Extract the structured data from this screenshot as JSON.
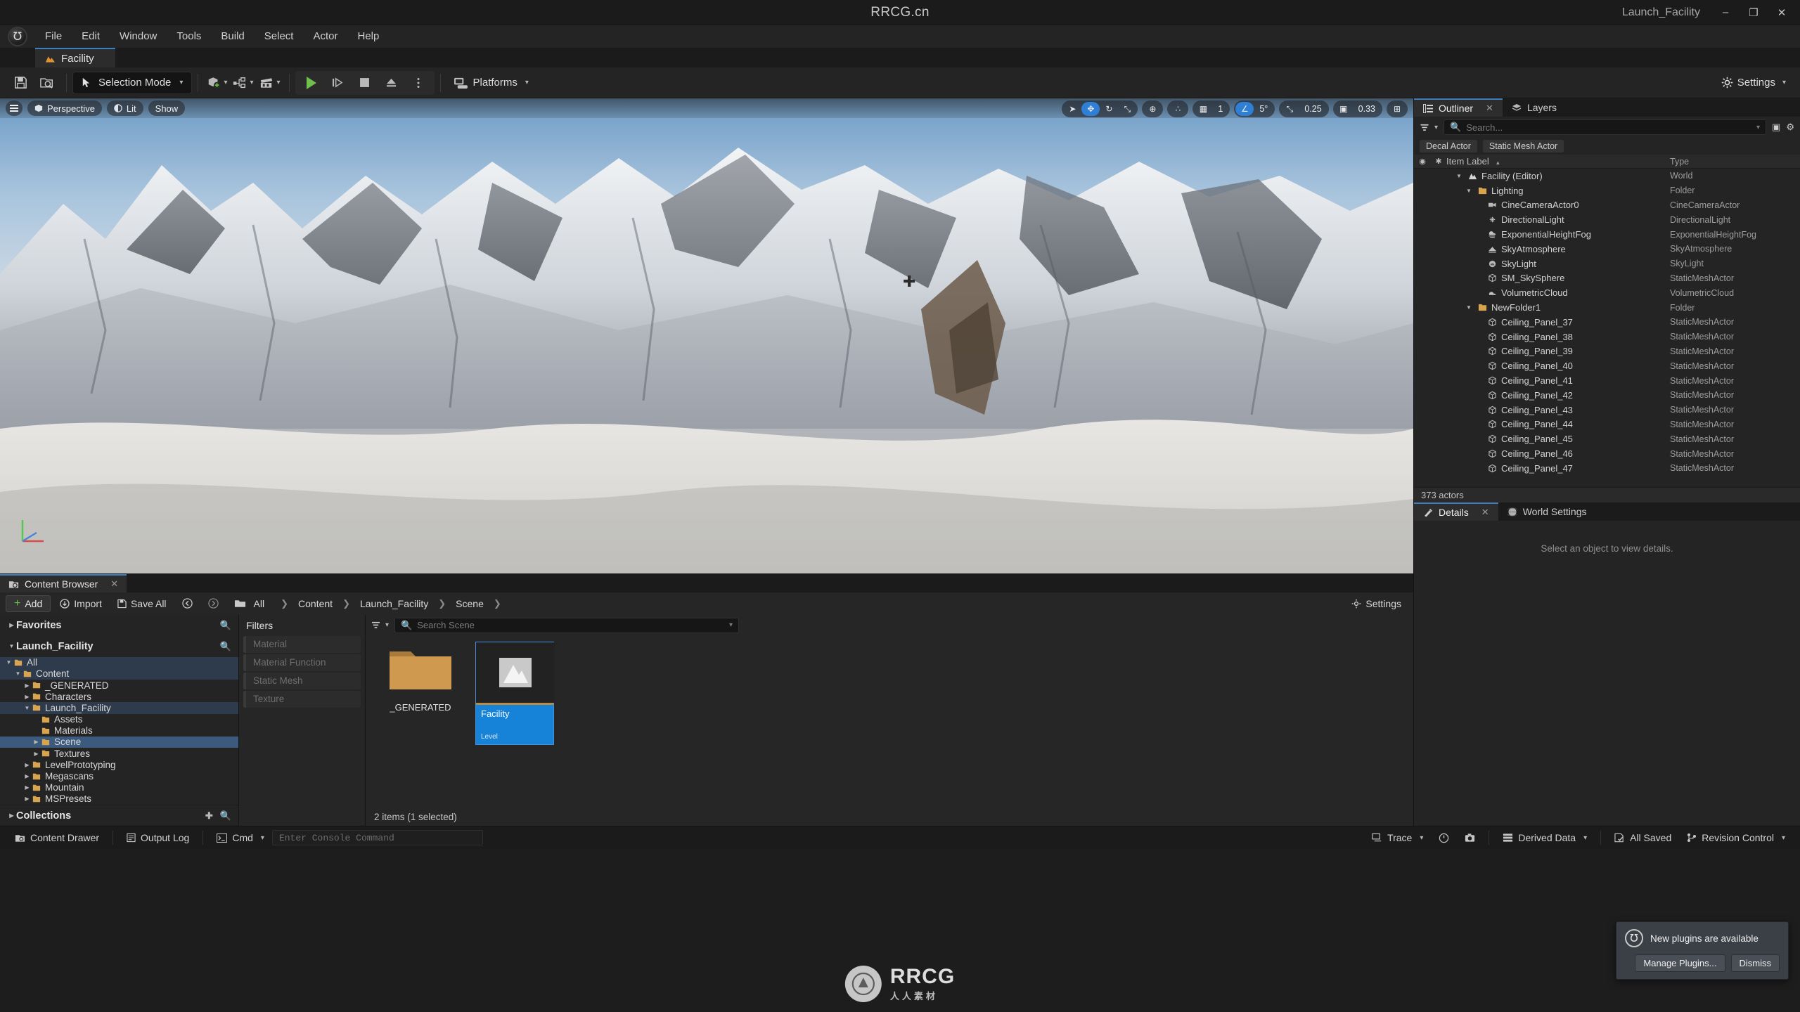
{
  "titlebar": {
    "app_title": "RRCG.cn",
    "project_right": "Launch_Facility",
    "minimize": "–",
    "maximize": "❐",
    "close": "✕"
  },
  "menu": {
    "logo_glyph": "℧",
    "items": [
      "File",
      "Edit",
      "Window",
      "Tools",
      "Build",
      "Select",
      "Actor",
      "Help"
    ]
  },
  "level_tab": {
    "label": "Facility"
  },
  "toolbar": {
    "save_tooltip": "Save",
    "browse_tooltip": "Browse",
    "mode_label": "Selection Mode",
    "add_tooltip": "Add Actor",
    "blueprint_tooltip": "Blueprints",
    "cinematics_tooltip": "Cinematics",
    "play_tooltip": "Play",
    "step_tooltip": "Skip",
    "stop_tooltip": "Stop",
    "eject_tooltip": "Eject",
    "more_tooltip": "More",
    "platforms_label": "Platforms",
    "settings_label": "Settings"
  },
  "viewport": {
    "menu_tooltip": "Viewport Options",
    "perspective_label": "Perspective",
    "lit_label": "Lit",
    "show_label": "Show",
    "snap_angle": "5°",
    "snap_scale": "0.25",
    "camera_speed": "0.33",
    "tools": [
      {
        "name": "select-tool",
        "glyph": "➤",
        "active": false
      },
      {
        "name": "move-tool",
        "glyph": "✥",
        "active": true
      },
      {
        "name": "rotate-tool",
        "glyph": "↻",
        "active": false
      },
      {
        "name": "scale-tool",
        "glyph": "⤡",
        "active": false
      }
    ],
    "coord_glyph": "⊕",
    "transform_glyph": "∴",
    "grid_glyph": "▦",
    "grid_value": "1",
    "angle_glyph": "∠",
    "scale_glyph": "⤡",
    "camera_glyph": "▣",
    "layout_glyph": "⊞"
  },
  "content_browser": {
    "tab_label": "Content Browser",
    "close_glyph": "✕",
    "add_label": "Add",
    "import_label": "Import",
    "save_all_label": "Save All",
    "breadcrumb": [
      "All",
      "Content",
      "Launch_Facility",
      "Scene"
    ],
    "favorites_label": "Favorites",
    "project_label": "Launch_Facility",
    "collections_label": "Collections",
    "filters_label": "Filters",
    "filter_options": [
      "Material",
      "Material Function",
      "Static Mesh",
      "Texture"
    ],
    "search_placeholder": "Search Scene",
    "settings_label": "Settings",
    "status": "2 items (1 selected)",
    "tree": [
      {
        "label": "All",
        "depth": 0,
        "arrow": "▼",
        "state": "hl"
      },
      {
        "label": "Content",
        "depth": 1,
        "arrow": "▼",
        "state": "hl"
      },
      {
        "label": "_GENERATED",
        "depth": 2,
        "arrow": "▶",
        "state": ""
      },
      {
        "label": "Characters",
        "depth": 2,
        "arrow": "▶",
        "state": ""
      },
      {
        "label": "Launch_Facility",
        "depth": 2,
        "arrow": "▼",
        "state": "hl"
      },
      {
        "label": "Assets",
        "depth": 3,
        "arrow": "",
        "state": ""
      },
      {
        "label": "Materials",
        "depth": 3,
        "arrow": "",
        "state": ""
      },
      {
        "label": "Scene",
        "depth": 3,
        "arrow": "▶",
        "state": "sel"
      },
      {
        "label": "Textures",
        "depth": 3,
        "arrow": "▶",
        "state": ""
      },
      {
        "label": "LevelPrototyping",
        "depth": 2,
        "arrow": "▶",
        "state": ""
      },
      {
        "label": "Megascans",
        "depth": 2,
        "arrow": "▶",
        "state": ""
      },
      {
        "label": "Mountain",
        "depth": 2,
        "arrow": "▶",
        "state": ""
      },
      {
        "label": "MSPresets",
        "depth": 2,
        "arrow": "▶",
        "state": ""
      }
    ],
    "tiles": [
      {
        "name": "_GENERATED",
        "kind": "folder",
        "type": "",
        "selected": false
      },
      {
        "name": "Facility",
        "kind": "asset",
        "type": "Level",
        "selected": true
      }
    ]
  },
  "outliner": {
    "tab_label": "Outliner",
    "layers_label": "Layers",
    "close_glyph": "✕",
    "search_placeholder": "Search...",
    "chips": [
      "Decal Actor",
      "Static Mesh Actor"
    ],
    "col_item_label": "Item Label",
    "col_type": "Type",
    "sort_glyph": "▲",
    "eye_glyph": "◉",
    "star_glyph": "✱",
    "footer": "373 actors",
    "rows": [
      {
        "label": "Facility (Editor)",
        "type": "World",
        "depth": 1,
        "arrow": "▼",
        "icon": "world"
      },
      {
        "label": "Lighting",
        "type": "Folder",
        "depth": 2,
        "arrow": "▼",
        "icon": "folder"
      },
      {
        "label": "CineCameraActor0",
        "type": "CineCameraActor",
        "depth": 3,
        "arrow": "",
        "icon": "camera"
      },
      {
        "label": "DirectionalLight",
        "type": "DirectionalLight",
        "depth": 3,
        "arrow": "",
        "icon": "light"
      },
      {
        "label": "ExponentialHeightFog",
        "type": "ExponentialHeightFog",
        "depth": 3,
        "arrow": "",
        "icon": "fog"
      },
      {
        "label": "SkyAtmosphere",
        "type": "SkyAtmosphere",
        "depth": 3,
        "arrow": "",
        "icon": "atmo"
      },
      {
        "label": "SkyLight",
        "type": "SkyLight",
        "depth": 3,
        "arrow": "",
        "icon": "skylight"
      },
      {
        "label": "SM_SkySphere",
        "type": "StaticMeshActor",
        "depth": 3,
        "arrow": "",
        "icon": "mesh"
      },
      {
        "label": "VolumetricCloud",
        "type": "VolumetricCloud",
        "depth": 3,
        "arrow": "",
        "icon": "cloud"
      },
      {
        "label": "NewFolder1",
        "type": "Folder",
        "depth": 2,
        "arrow": "▼",
        "icon": "folder"
      },
      {
        "label": "Ceiling_Panel_37",
        "type": "StaticMeshActor",
        "depth": 3,
        "arrow": "",
        "icon": "mesh"
      },
      {
        "label": "Ceiling_Panel_38",
        "type": "StaticMeshActor",
        "depth": 3,
        "arrow": "",
        "icon": "mesh"
      },
      {
        "label": "Ceiling_Panel_39",
        "type": "StaticMeshActor",
        "depth": 3,
        "arrow": "",
        "icon": "mesh"
      },
      {
        "label": "Ceiling_Panel_40",
        "type": "StaticMeshActor",
        "depth": 3,
        "arrow": "",
        "icon": "mesh"
      },
      {
        "label": "Ceiling_Panel_41",
        "type": "StaticMeshActor",
        "depth": 3,
        "arrow": "",
        "icon": "mesh"
      },
      {
        "label": "Ceiling_Panel_42",
        "type": "StaticMeshActor",
        "depth": 3,
        "arrow": "",
        "icon": "mesh"
      },
      {
        "label": "Ceiling_Panel_43",
        "type": "StaticMeshActor",
        "depth": 3,
        "arrow": "",
        "icon": "mesh"
      },
      {
        "label": "Ceiling_Panel_44",
        "type": "StaticMeshActor",
        "depth": 3,
        "arrow": "",
        "icon": "mesh"
      },
      {
        "label": "Ceiling_Panel_45",
        "type": "StaticMeshActor",
        "depth": 3,
        "arrow": "",
        "icon": "mesh"
      },
      {
        "label": "Ceiling_Panel_46",
        "type": "StaticMeshActor",
        "depth": 3,
        "arrow": "",
        "icon": "mesh"
      },
      {
        "label": "Ceiling_Panel_47",
        "type": "StaticMeshActor",
        "depth": 3,
        "arrow": "",
        "icon": "mesh"
      }
    ]
  },
  "details": {
    "tab_label": "Details",
    "world_settings_label": "World Settings",
    "close_glyph": "✕",
    "empty_message": "Select an object to view details."
  },
  "statusbar": {
    "content_drawer": "Content Drawer",
    "output_log": "Output Log",
    "cmd_label": "Cmd",
    "console_placeholder": "Enter Console Command",
    "trace_label": "Trace",
    "derived_data_label": "Derived Data",
    "all_saved_label": "All Saved",
    "revision_control_label": "Revision Control"
  },
  "notification": {
    "message": "New plugins are available",
    "manage_label": "Manage Plugins...",
    "dismiss_label": "Dismiss",
    "icon_glyph": "℧"
  },
  "watermark": {
    "brand": "RRCG",
    "sub": "人人素材"
  },
  "colors": {
    "accent_blue": "#2f7fd4",
    "selection_blue": "#1683d8",
    "play_green": "#6fc04b",
    "folder_orange": "#d9a44f",
    "panel_bg": "#242424"
  }
}
